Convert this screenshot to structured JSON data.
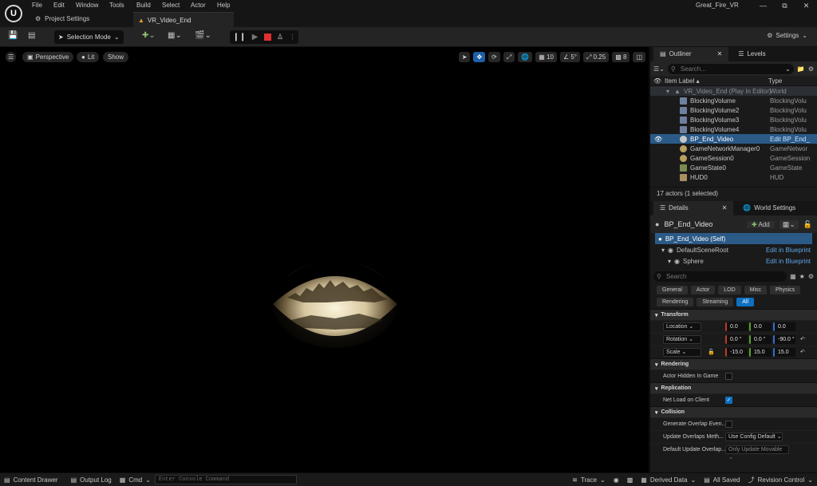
{
  "menu": [
    "File",
    "Edit",
    "Window",
    "Tools",
    "Build",
    "Select",
    "Actor",
    "Help"
  ],
  "project_name": "Great_Fire_VR",
  "tabs": {
    "project_settings": "Project Settings",
    "level": "VR_Video_End"
  },
  "toolbar": {
    "selection_mode": "Selection Mode",
    "settings": "Settings"
  },
  "viewport": {
    "perspective": "Perspective",
    "lit": "Lit",
    "show": "Show",
    "grid": "10",
    "angle": "5°",
    "scale": "0.25",
    "cam": "8"
  },
  "outliner": {
    "tab": "Outliner",
    "levels_tab": "Levels",
    "search_placeholder": "Search...",
    "col_label": "Item Label ▴",
    "col_type": "Type",
    "world_row": {
      "label": "VR_Video_End (Play In Editor)",
      "type": "World"
    },
    "rows": [
      {
        "label": "BlockingVolume",
        "type": "BlockingVolu"
      },
      {
        "label": "BlockingVolume2",
        "type": "BlockingVolu"
      },
      {
        "label": "BlockingVolume3",
        "type": "BlockingVolu"
      },
      {
        "label": "BlockingVolume4",
        "type": "BlockingVolu"
      },
      {
        "label": "BP_End_Video",
        "type": "Edit BP_End_"
      },
      {
        "label": "GameNetworkManager0",
        "type": "GameNetwor"
      },
      {
        "label": "GameSession0",
        "type": "GameSession"
      },
      {
        "label": "GameState0",
        "type": "GameState"
      },
      {
        "label": "HUD0",
        "type": "HUD"
      }
    ],
    "status": "17 actors (1 selected)"
  },
  "details": {
    "tab": "Details",
    "world_settings_tab": "World Settings",
    "actor_name": "BP_End_Video",
    "add_label": "Add",
    "components": [
      {
        "label": "BP_End_Video (Self)",
        "action": ""
      },
      {
        "label": "DefaultSceneRoot",
        "action": "Edit in Blueprint"
      },
      {
        "label": "Sphere",
        "action": "Edit in Blueprint"
      }
    ],
    "search_placeholder": "Search",
    "categories": [
      "General",
      "Actor",
      "LOD",
      "Misc",
      "Physics",
      "Rendering",
      "Streaming",
      "All"
    ],
    "transform": {
      "title": "Transform",
      "location": {
        "label": "Location",
        "x": "0.0",
        "y": "0.0",
        "z": "0.0"
      },
      "rotation": {
        "label": "Rotation",
        "x": "0.0 °",
        "y": "0.0 °",
        "z": "-90.0 °"
      },
      "scale": {
        "label": "Scale",
        "x": "-15.0",
        "y": "15.0",
        "z": "15.0"
      }
    },
    "rendering": {
      "title": "Rendering",
      "hidden_label": "Actor Hidden In Game"
    },
    "replication": {
      "title": "Replication",
      "net_load_label": "Net Load on Client"
    },
    "collision": {
      "title": "Collision",
      "gen_overlap_label": "Generate Overlap Even...",
      "update_overlap_label": "Update Overlaps Meth...",
      "update_overlap_value": "Use Config Default",
      "default_overlap_label": "Default Update Overlap...",
      "default_overlap_value": "Only Update Movable"
    }
  },
  "statusbar": {
    "content_drawer": "Content Drawer",
    "output_log": "Output Log",
    "cmd": "Cmd",
    "console_placeholder": "Enter Console Command",
    "trace": "Trace",
    "derived_data": "Derived Data",
    "all_saved": "All Saved",
    "revision": "Revision Control"
  },
  "colors": {
    "selection": "#2b5a87",
    "accent": "#0e70c0",
    "stop": "#e03030"
  }
}
